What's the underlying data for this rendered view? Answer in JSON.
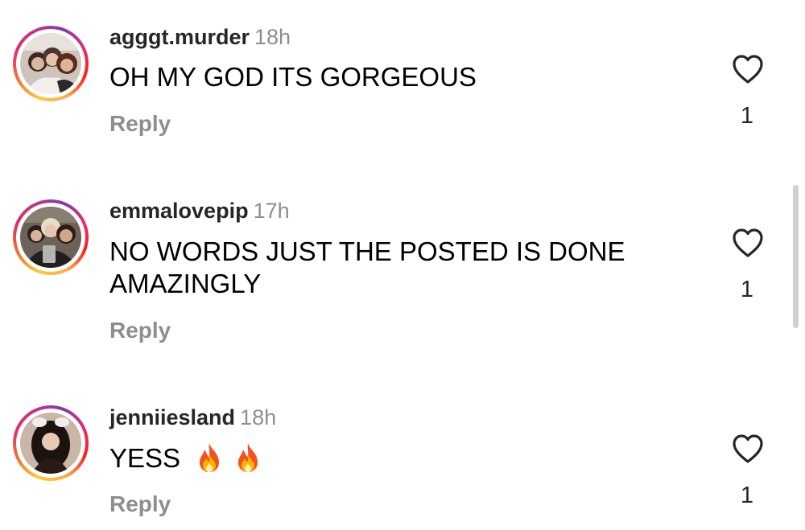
{
  "comments": [
    {
      "username": "agggt.murder",
      "time": "18h",
      "text": "OH MY GOD ITS GORGEOUS",
      "reply_label": "Reply",
      "like_count": "1"
    },
    {
      "username": "emmalovepip",
      "time": "17h",
      "text": "NO WORDS JUST THE POSTED IS DONE AMAZINGLY",
      "reply_label": "Reply",
      "like_count": "1"
    },
    {
      "username": "jenniiesland",
      "time": "18h",
      "text": "YESS",
      "emoji": [
        "fire-emoji",
        "fire-emoji"
      ],
      "reply_label": "Reply",
      "like_count": "1"
    }
  ],
  "icons": {
    "like": "heart-outline-icon"
  },
  "colors": {
    "story_ring": [
      "#fdc830",
      "#f37335",
      "#e1306c",
      "#833ab4"
    ],
    "secondary_text": "#8e8e8e"
  }
}
